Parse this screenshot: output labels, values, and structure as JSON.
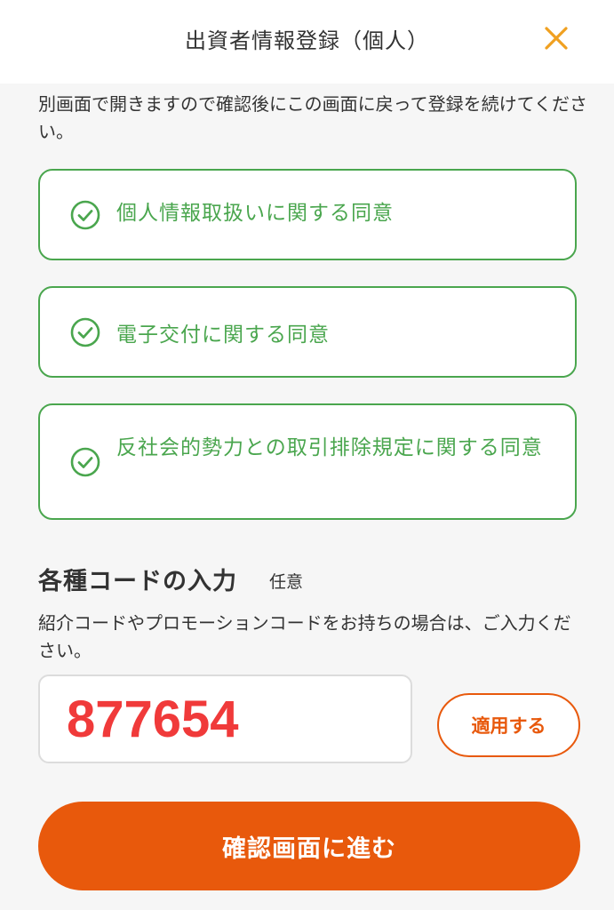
{
  "header": {
    "title": "出資者情報登録（個人）",
    "close_icon": "close-icon"
  },
  "note": {
    "text": "別画面で開きますので確認後にこの画面に戻って登録を続けてください。"
  },
  "consents": [
    {
      "label": "個人情報取扱いに関する同意",
      "checked": true,
      "icon": "check-circle-icon"
    },
    {
      "label": "電子交付に関する同意",
      "checked": true,
      "icon": "check-circle-icon"
    },
    {
      "label": "反社会的勢力との取引排除規定に関する同意",
      "checked": true,
      "icon": "check-circle-icon"
    }
  ],
  "code_section": {
    "title": "各種コードの入力",
    "optional_label": "任意",
    "description": "紹介コードやプロモーションコードをお持ちの場合は、ご入力ください。",
    "input_value": "877654",
    "apply_label": "適用する"
  },
  "confirm_button": {
    "label": "確認画面に進む"
  },
  "colors": {
    "accent": "#e8590c",
    "consent_green": "#4aa64e",
    "code_value": "#f03a3a",
    "close_icon": "#f0a020"
  }
}
